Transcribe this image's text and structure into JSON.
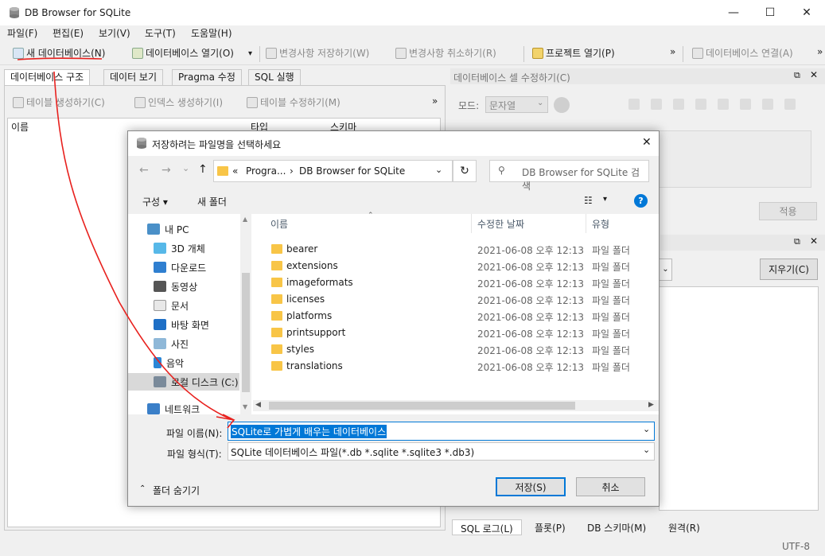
{
  "window": {
    "title": "DB Browser for SQLite",
    "minimize": "—",
    "maximize": "☐",
    "close": "✕"
  },
  "menu": [
    "파일(F)",
    "편집(E)",
    "보기(V)",
    "도구(T)",
    "도움말(H)"
  ],
  "toolbar": {
    "new_db": "새 데이터베이스(N)",
    "open_db": "데이터베이스 열기(O)",
    "open_dropdown": "▾",
    "save_changes": "변경사항 저장하기(W)",
    "revert_changes": "변경사항 취소하기(R)",
    "open_project": "프로젝트 열기(P)",
    "overflow1": "»",
    "attach_db": "데이터베이스 연결(A)",
    "overflow2": "»"
  },
  "main_tabs": [
    "데이터베이스 구조",
    "데이터 보기",
    "Pragma 수정",
    "SQL 실행"
  ],
  "structure_toolbar": {
    "create_table": "테이블 생성하기(C)",
    "create_index": "인덱스 생성하기(I)",
    "modify_table": "테이블 수정하기(M)",
    "overflow": "»"
  },
  "structure_columns": [
    "이름",
    "타입",
    "스키마"
  ],
  "edit_cell": {
    "title": "데이터베이스 셀 수정하기(C)",
    "mode_label": "모드:",
    "mode_value": "문자열",
    "apply": "적용"
  },
  "sql_log": {
    "clear": "지우기(C)"
  },
  "bottom_tabs": [
    "SQL 로그(L)",
    "플롯(P)",
    "DB 스키마(M)",
    "원격(R)"
  ],
  "status": {
    "encoding": "UTF-8"
  },
  "dialog": {
    "title": "저장하려는 파일명을 선택하세요",
    "close": "✕",
    "back": "←",
    "forward": "→",
    "recent": "⌄",
    "up": "↑",
    "path": [
      "«",
      "Progra...",
      "›",
      "DB Browser for SQLite"
    ],
    "refresh": "↻",
    "search_placeholder": "DB Browser for SQLite 검색",
    "organize": "구성 ▾",
    "new_folder": "새 폴더",
    "view_options": "▾",
    "help": "?",
    "nav": [
      "내 PC",
      "3D 개체",
      "다운로드",
      "동영상",
      "문서",
      "바탕 화면",
      "사진",
      "음악",
      "로컬 디스크 (C:)",
      "네트워크"
    ],
    "columns": {
      "name": "이름",
      "modified": "수정한 날짜",
      "type": "유형"
    },
    "files": [
      {
        "name": "bearer",
        "date": "2021-06-08 오후 12:13",
        "type": "파일 폴더"
      },
      {
        "name": "extensions",
        "date": "2021-06-08 오후 12:13",
        "type": "파일 폴더"
      },
      {
        "name": "imageformats",
        "date": "2021-06-08 오후 12:13",
        "type": "파일 폴더"
      },
      {
        "name": "licenses",
        "date": "2021-06-08 오후 12:13",
        "type": "파일 폴더"
      },
      {
        "name": "platforms",
        "date": "2021-06-08 오후 12:13",
        "type": "파일 폴더"
      },
      {
        "name": "printsupport",
        "date": "2021-06-08 오후 12:13",
        "type": "파일 폴더"
      },
      {
        "name": "styles",
        "date": "2021-06-08 오후 12:13",
        "type": "파일 폴더"
      },
      {
        "name": "translations",
        "date": "2021-06-08 오후 12:13",
        "type": "파일 폴더"
      }
    ],
    "filename_label": "파일 이름(N):",
    "filename_value": "SQLite로 가볍게 배우는 데이터베이스",
    "filetype_label": "파일 형식(T):",
    "filetype_value": "SQLite 데이터베이스 파일(*.db *.sqlite *.sqlite3 *.db3)",
    "hide_folders": "폴더 숨기기",
    "save": "저장(S)",
    "cancel": "취소"
  },
  "colors": {
    "accent": "#0078d7",
    "folder": "#f8c547",
    "annotation": "#e8211e"
  }
}
